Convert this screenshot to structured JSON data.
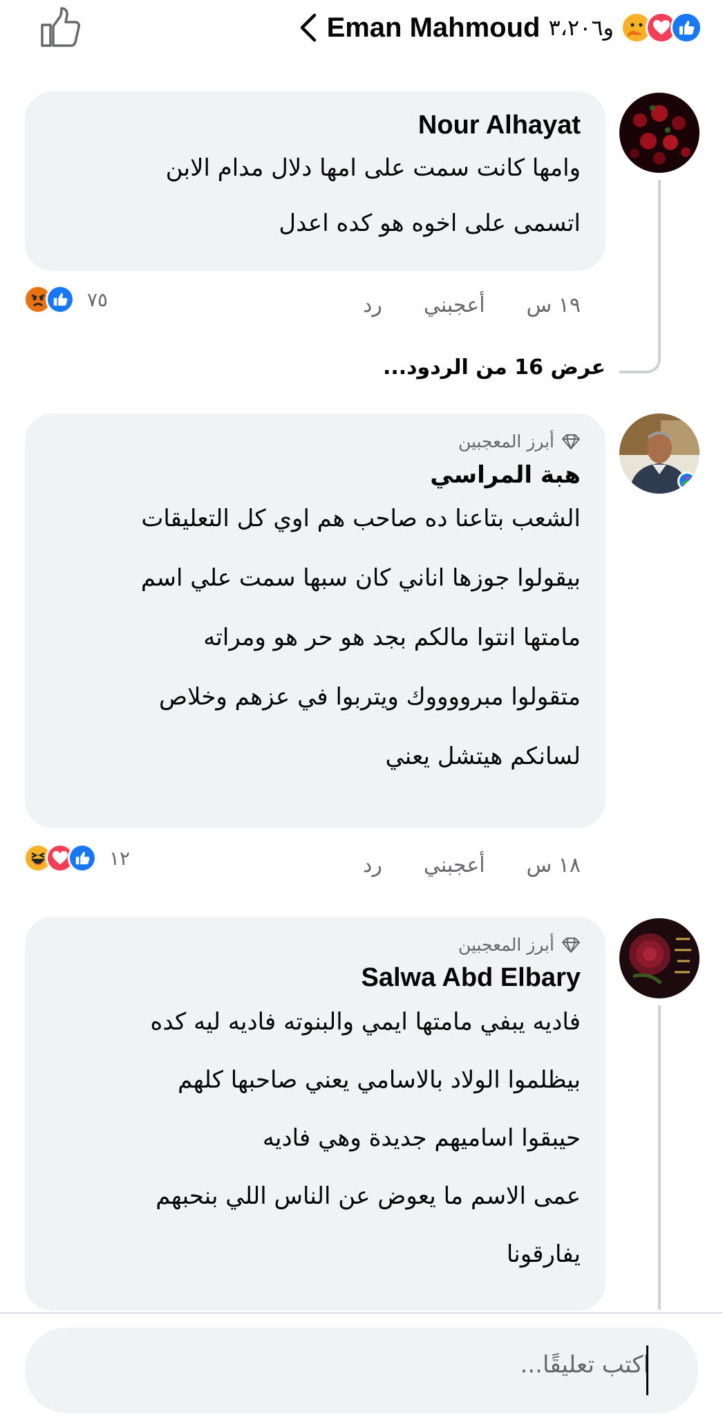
{
  "header": {
    "title": "Eman Mahmoud",
    "reaction_count": "و٣،٢٠٦",
    "reaction_icons": [
      "like-icon",
      "love-icon",
      "care-icon"
    ]
  },
  "comments": [
    {
      "author": "Nour Alhayat",
      "top_fan": null,
      "lines": [
        "وامها كانت سمت على امها دلال مدام الابن",
        "اتسمى على اخوه هو كده اعدل"
      ],
      "time": "١٩ س",
      "like_label": "أعجبني",
      "reply_label": "رد",
      "reaction_count": "٧٥",
      "reactions": [
        "like-icon",
        "angry-icon"
      ],
      "view_replies": "عرض 16 من الردود..."
    },
    {
      "author": "هبة المراسي",
      "top_fan": "أبرز المعجبين",
      "lines": [
        "الشعب بتاعنا ده صاحب هم اوي كل التعليقات",
        "بيقولوا جوزها اناني كان سبها سمت علي اسم",
        "مامتها انتوا مالكم بجد هو حر هو ومراته",
        "متقولوا مبرووووك ويتربوا في عزهم وخلاص",
        "لسانكم هيتشل يعني"
      ],
      "time": "١٨ س",
      "like_label": "أعجبني",
      "reply_label": "رد",
      "reaction_count": "١٢",
      "reactions": [
        "like-icon",
        "love-icon",
        "haha-icon"
      ]
    },
    {
      "author": "Salwa Abd Elbary",
      "top_fan": "أبرز المعجبين",
      "lines": [
        "فاديه يبفي مامتها ايمي والبنوته فاديه ليه كده",
        "بيظلموا الولاد بالاسامي يعني صاحبها كلهم",
        "حيبقوا اساميهم جديدة وهي فاديه",
        "عمى الاسم ما يعوض عن الناس اللي بنحبهم",
        "يفارقونا"
      ]
    }
  ],
  "composer": {
    "placeholder": "اكتب تعليقًا..."
  },
  "colors": {
    "like": "#1877f2",
    "love": "#f33e58",
    "care": "#f7b125",
    "bubble": "#f0f2f5",
    "secondary_text": "#65676b"
  }
}
